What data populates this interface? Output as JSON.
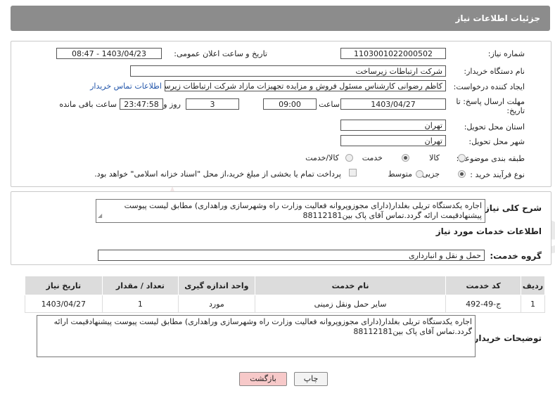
{
  "header": {
    "title": "جزئیات اطلاعات نیاز"
  },
  "fields": {
    "need_number_label": "شماره نیاز:",
    "need_number": "1103001022000502",
    "announce_label": "تاریخ و ساعت اعلان عمومی:",
    "announce_value": "1403/04/23 - 08:47",
    "buyer_org_label": "نام دستگاه خریدار:",
    "buyer_org": "شرکت ارتباطات زیرساخت",
    "creator_label": "ایجاد کننده درخواست:",
    "creator": "کاظم رضوانی کارشناس مسئول فروش و مزایده تجهیزات مازاد شرکت ارتباطات زیرساخت",
    "contact_link": "اطلاعات تماس خریدار",
    "deadline_label_1": "مهلت ارسال پاسخ: تا",
    "deadline_label_2": "تاریخ:",
    "deadline_date": "1403/04/27",
    "time_label": "ساعت",
    "deadline_time": "09:00",
    "days_count": "3",
    "days_label": "روز و",
    "remaining_time": "23:47:58",
    "remaining_label": "ساعت باقی مانده",
    "province_label": "استان محل تحویل:",
    "province": "تهران",
    "city_label": "شهر محل تحویل:",
    "city": "تهران",
    "category_label": "طبقه بندی موضوعی:",
    "category_options": [
      "کالا",
      "خدمت",
      "کالا/خدمت"
    ],
    "category_selected": "خدمت",
    "process_label": "نوع فرآیند خرید :",
    "process_options": [
      "جزیی",
      "متوسط"
    ],
    "process_selected": "جزیی",
    "payment_note": "پرداخت تمام یا بخشی از مبلغ خرید،از محل \"اسناد خزانه اسلامی\" خواهد بود."
  },
  "summary": {
    "label": "شرح کلی نیاز:",
    "text": "اجاره یکدستگاه تریلی بغلدار(دارای مجوزوپروانه فعالیت وزارت راه وشهرسازی وراهداری) مطابق لیست پیوست پیشنهادقیمت ارائه گردد.تماس آقای پاک بین88112181"
  },
  "services": {
    "section_title": "اطلاعات خدمات مورد نیاز",
    "group_label": "گروه خدمت:",
    "group_value": "حمل و نقل و انبارداری",
    "columns": [
      "ردیف",
      "کد خدمت",
      "نام خدمت",
      "واحد اندازه گیری",
      "تعداد / مقدار",
      "تاریخ نیاز"
    ],
    "rows": [
      [
        "1",
        "ج-49-492",
        "سایر حمل ونقل زمینی",
        "مورد",
        "1",
        "1403/04/27"
      ]
    ]
  },
  "buyer_notes": {
    "label": "توضیحات خریدار:",
    "text": "اجاره یکدستگاه تریلی بغلدار(دارای مجوزوپروانه فعالیت وزارت راه وشهرسازی وراهداری) مطابق لیست پیوست پیشنهادقیمت ارائه گردد.تماس آقای پاک بین88112181"
  },
  "buttons": {
    "print": "چاپ",
    "back": "بازگشت"
  },
  "colors": {
    "header_bg": "#8c8c8c",
    "table_header": "#dcdcdc",
    "back_button": "#f7c9c9",
    "link": "#2255aa"
  }
}
